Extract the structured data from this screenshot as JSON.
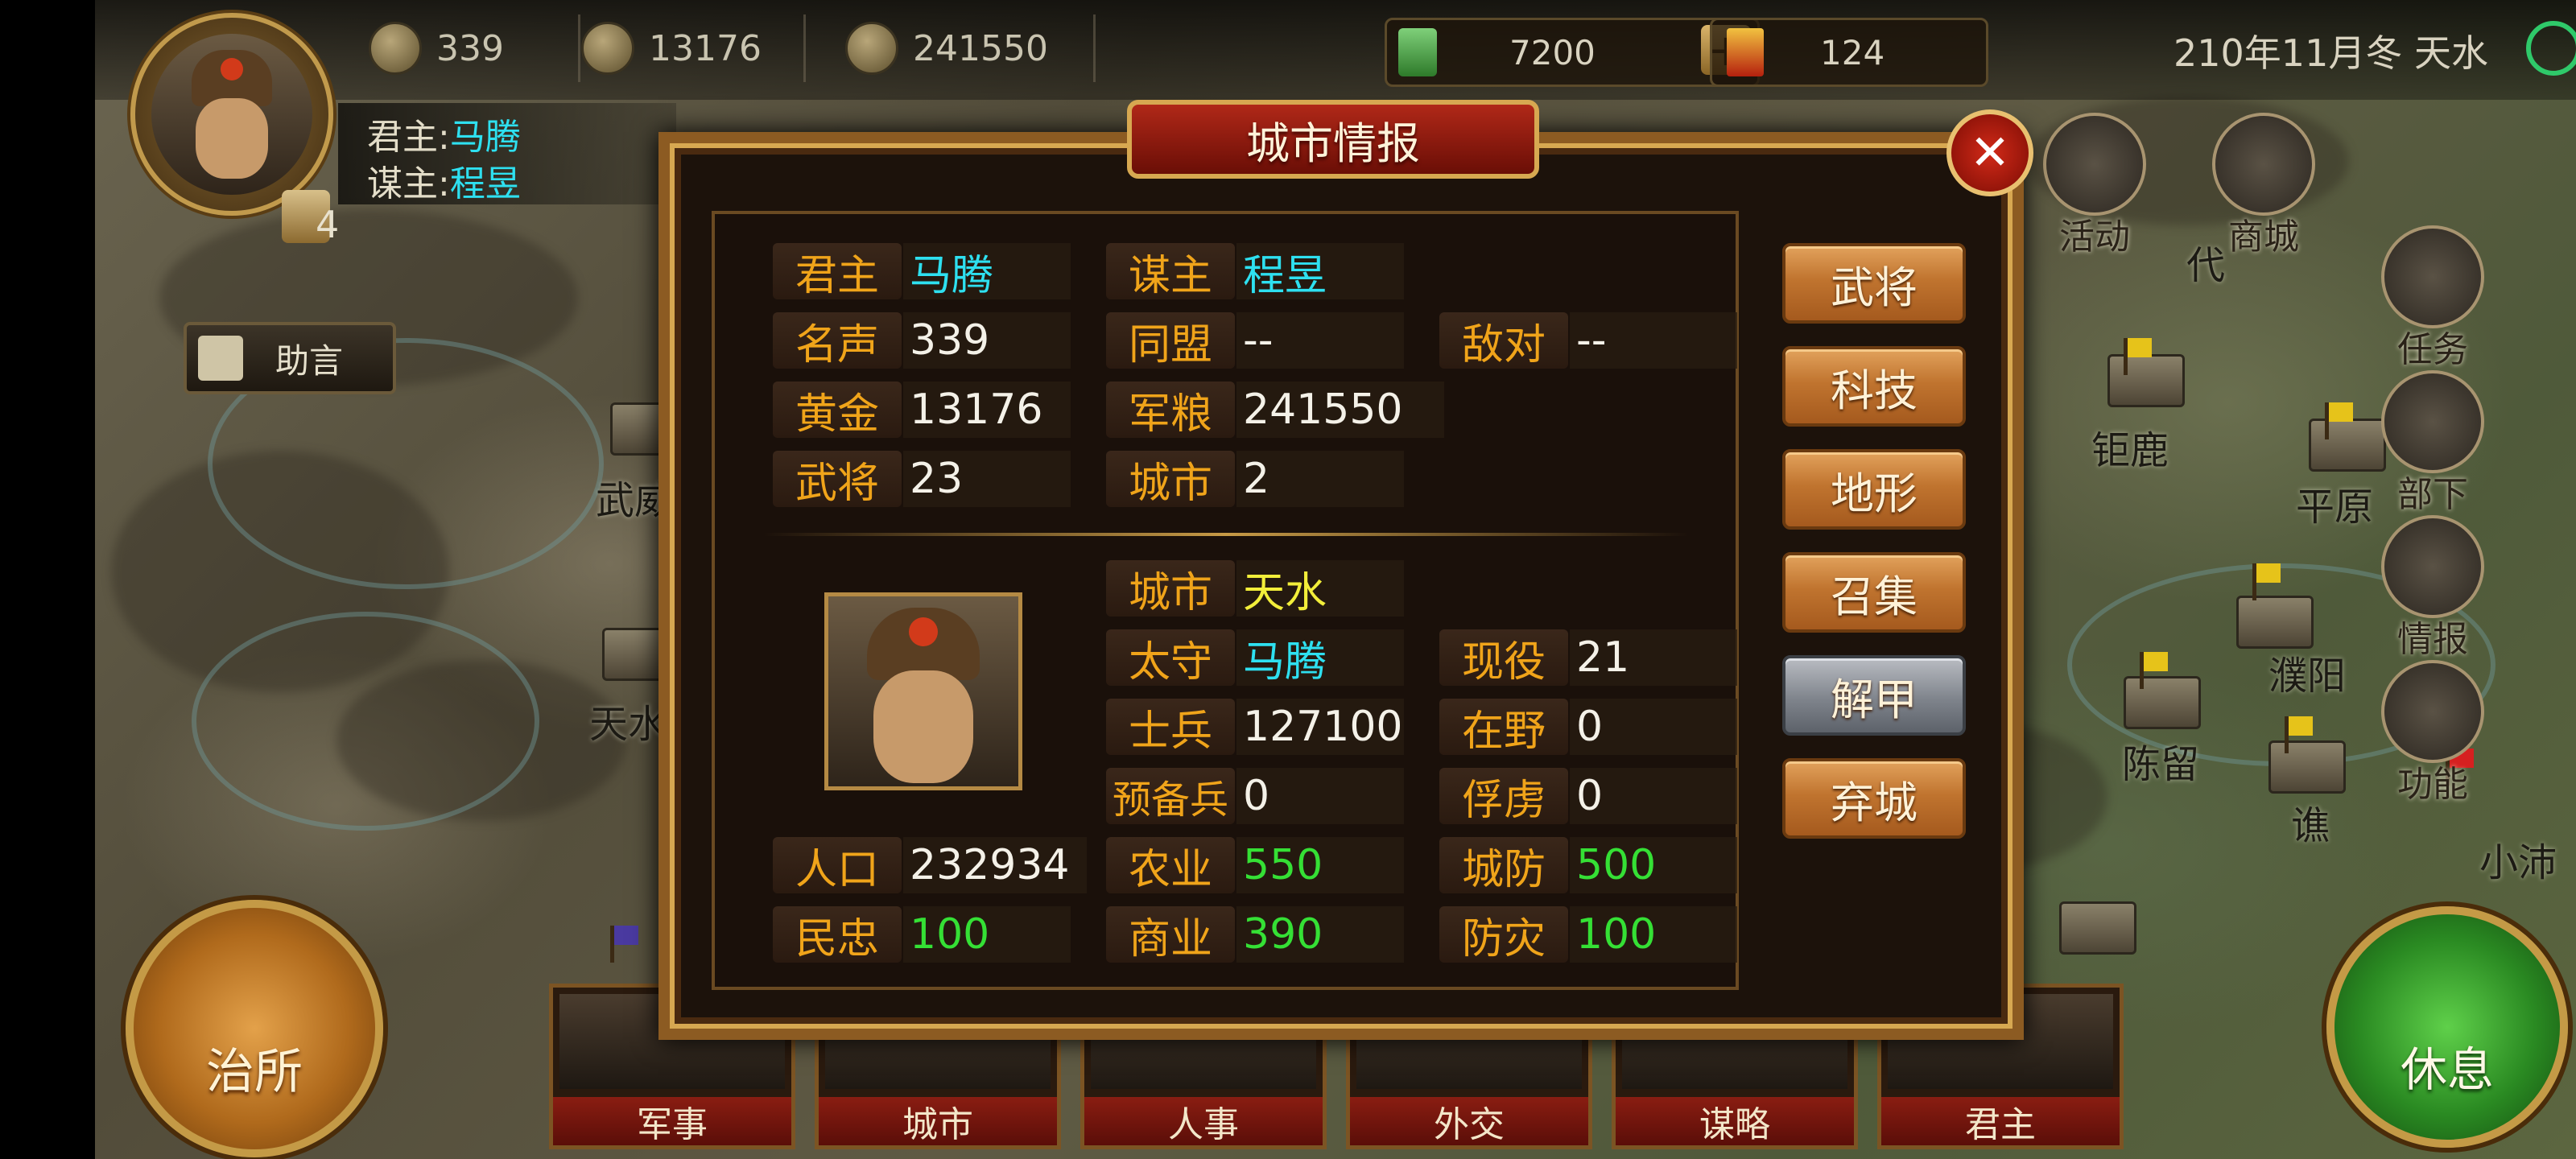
{
  "topbar": {
    "resources": [
      {
        "name": "fame",
        "value": "339"
      },
      {
        "name": "gold",
        "value": "13176"
      },
      {
        "name": "grain",
        "value": "241550"
      }
    ],
    "jade": "7200",
    "plus": "+",
    "tokens": "124",
    "date": "210年11月冬 天水"
  },
  "player": {
    "lord_label": "君主:",
    "lord_name": "马腾",
    "advisor_label": "谋主:",
    "advisor_name": "程昱",
    "badge_count": "4"
  },
  "map": {
    "advice_label": "助言",
    "places": [
      "武威",
      "天水",
      "钜鹿",
      "平原",
      "濮阳",
      "陈留",
      "谯",
      "小沛",
      "代"
    ],
    "side_buttons": [
      "活动",
      "商城",
      "任务",
      "部下",
      "情报",
      "功能"
    ],
    "governor_button": "治所",
    "rest_button": "休息",
    "bottom_tabs": [
      "军事",
      "城市",
      "人事",
      "外交",
      "谋略",
      "君主"
    ]
  },
  "dialog": {
    "title": "城市情报",
    "close": "✕",
    "faction": {
      "lord_label": "君主",
      "lord_value": "马腾",
      "advisor_label": "谋主",
      "advisor_value": "程昱",
      "fame_label": "名声",
      "fame_value": "339",
      "alliance_label": "同盟",
      "alliance_value": "--",
      "enemy_label": "敌对",
      "enemy_value": "--",
      "gold_label": "黄金",
      "gold_value": "13176",
      "grain_label": "军粮",
      "grain_value": "241550",
      "generals_label": "武将",
      "generals_value": "23",
      "cities_label": "城市",
      "cities_value": "2"
    },
    "city": {
      "city_label": "城市",
      "city_value": "天水",
      "governor_label": "太守",
      "governor_value": "马腾",
      "active_label": "现役",
      "active_value": "21",
      "soldiers_label": "士兵",
      "soldiers_value": "127100",
      "wild_label": "在野",
      "wild_value": "0",
      "reserve_label": "预备兵",
      "reserve_value": "0",
      "captive_label": "俘虏",
      "captive_value": "0",
      "population_label": "人口",
      "population_value": "232934",
      "agriculture_label": "农业",
      "agriculture_value": "550",
      "defense_label": "城防",
      "defense_value": "500",
      "loyalty_label": "民忠",
      "loyalty_value": "100",
      "commerce_label": "商业",
      "commerce_value": "390",
      "disaster_label": "防灾",
      "disaster_value": "100"
    },
    "actions": [
      "武将",
      "科技",
      "地形",
      "召集",
      "解甲",
      "弃城"
    ]
  },
  "colors": {
    "label": "#f0a41a",
    "name_cyan": "#2ee0f0",
    "city_yellow": "#f2ee3a",
    "good_green": "#35e035",
    "dialog_border": "#8c5b22",
    "title_red": "#8a1d12"
  }
}
